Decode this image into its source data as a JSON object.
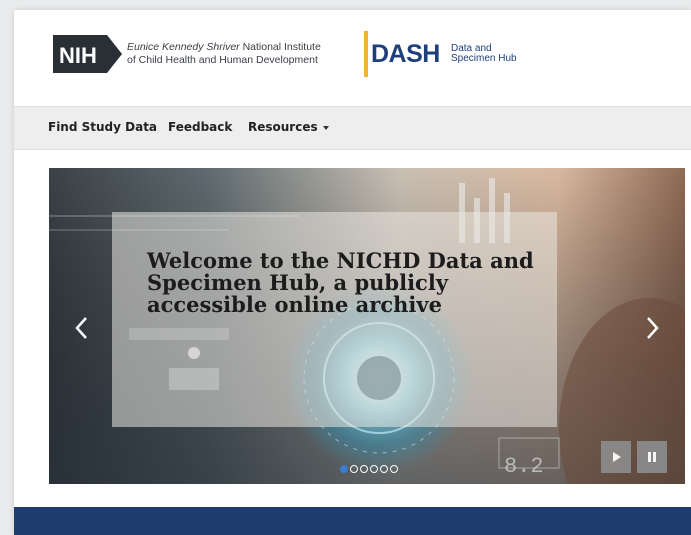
{
  "header": {
    "nih_logo_text": "NIH",
    "institute_line1_italic": "Eunice Kennedy Shriver",
    "institute_line1_rest": "National Institute",
    "institute_line2": "of Child Health and Human Development",
    "dash_word": "DASH",
    "dash_sub_line1": "Data and",
    "dash_sub_line2": "Specimen Hub"
  },
  "nav": {
    "items": [
      {
        "label": "Find Study Data"
      },
      {
        "label": "Feedback"
      },
      {
        "label": "Resources"
      }
    ]
  },
  "carousel": {
    "caption": "Welcome to the NICHD Data and Specimen Hub, a publicly accessible online archive",
    "slide_count": 6,
    "active_slide": 1
  },
  "colors": {
    "brand_navy": "#1d3d6e",
    "dash_blue": "#1e3f7a",
    "dash_accent": "#f2b233",
    "active_dot": "#3a7bd5"
  },
  "icons": [
    "chevron-left-icon",
    "chevron-right-icon",
    "play-icon",
    "pause-icon",
    "caret-down-icon"
  ]
}
